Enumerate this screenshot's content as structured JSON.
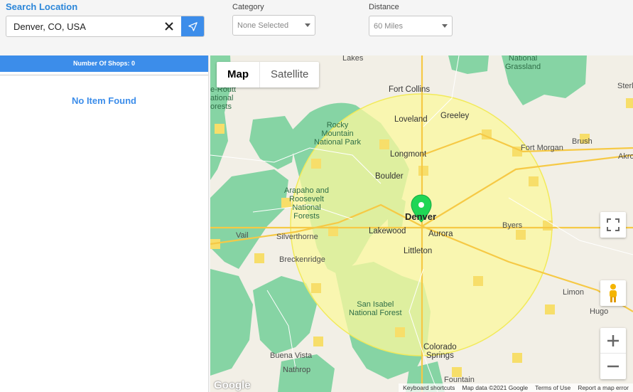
{
  "search": {
    "label": "Search Location",
    "value": "Denver, CO, USA"
  },
  "category": {
    "label": "Category",
    "selected": "None Selected"
  },
  "distance": {
    "label": "Distance",
    "selected": "60 Miles"
  },
  "list": {
    "count_label": "Number Of Shops: 0",
    "empty_text": "No Item Found"
  },
  "map": {
    "types": [
      "Map",
      "Satellite"
    ],
    "center_city": "Denver",
    "labels": {
      "lakes": "Lakes",
      "national_grassland": "National\nGrassland",
      "fort_collins": "Fort Collins",
      "sterling": "Sterl",
      "loveland": "Loveland",
      "greeley": "Greeley",
      "rmnp": "Rocky\nMountain\nNational Park",
      "fort_morgan": "Fort Morgan",
      "brush": "Brush",
      "akron": "Akro",
      "longmont": "Longmont",
      "boulder": "Boulder",
      "arapaho": "Arapaho and\nRoosevelt\nNational\nForests",
      "lakewood": "Lakewood",
      "aurora": "Aurora",
      "byers": "Byers",
      "vail": "Vail",
      "silverthorne": "Silverthorne",
      "breckenridge": "Breckenridge",
      "littleton": "Littleton",
      "route": "e-Routt\national\norests",
      "limon": "Limon",
      "san_isabel": "San Isabel\nNational Forest",
      "hugo": "Hugo",
      "buena_vista": "Buena Vista",
      "colorado_springs": "Colorado\nSprings",
      "nathrop": "Nathrop",
      "fountain": "Fountain"
    },
    "footer": [
      "Keyboard shortcuts",
      "Map data ©2021 Google",
      "Terms of Use",
      "Report a map error"
    ],
    "logo": "Google",
    "colors": {
      "radius_fill": "#fbf89e",
      "forest": "#7fd3a0",
      "accent": "#3c8dea",
      "marker": "#1fd655"
    }
  }
}
